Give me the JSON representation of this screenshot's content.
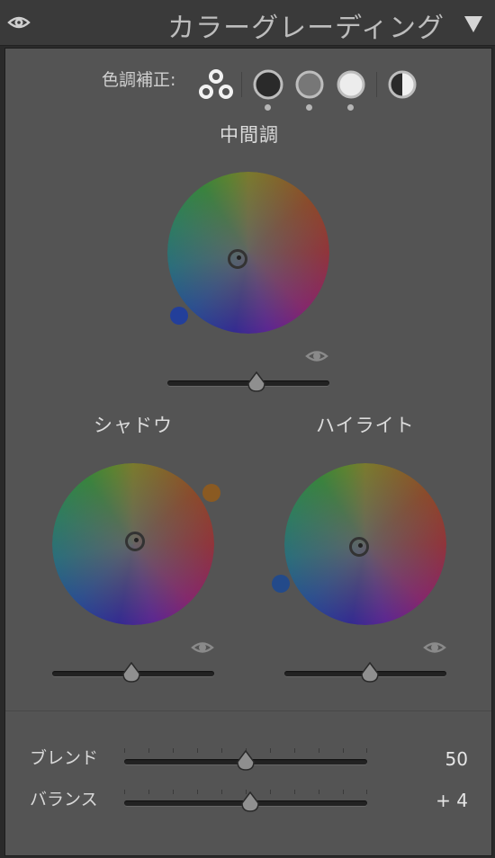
{
  "header": {
    "title": "カラーグレーディング",
    "eye_icon": "eye-icon",
    "collapse_icon": "triangle-down-icon"
  },
  "adjust": {
    "label": "色調補正:",
    "modes": [
      {
        "name": "3-way",
        "icon": "three-circles-icon"
      },
      {
        "name": "shadows",
        "icon": "dark-circle-icon"
      },
      {
        "name": "midtones",
        "icon": "mid-circle-icon"
      },
      {
        "name": "highlights",
        "icon": "light-circle-icon"
      },
      {
        "name": "global",
        "icon": "half-circle-icon"
      }
    ]
  },
  "midtones": {
    "label": "中間調",
    "swatch_color": "#233f9a",
    "slider_value": 0.55
  },
  "shadows": {
    "label": "シャドウ",
    "swatch_color": "#8a5a22",
    "slider_value": 0.49
  },
  "highlights": {
    "label": "ハイライト",
    "swatch_color": "#234a8a",
    "slider_value": 0.53
  },
  "blend": {
    "label": "ブレンド",
    "value": "50",
    "position": 0.5
  },
  "balance": {
    "label": "バランス",
    "value": "+ 4",
    "position": 0.52
  }
}
